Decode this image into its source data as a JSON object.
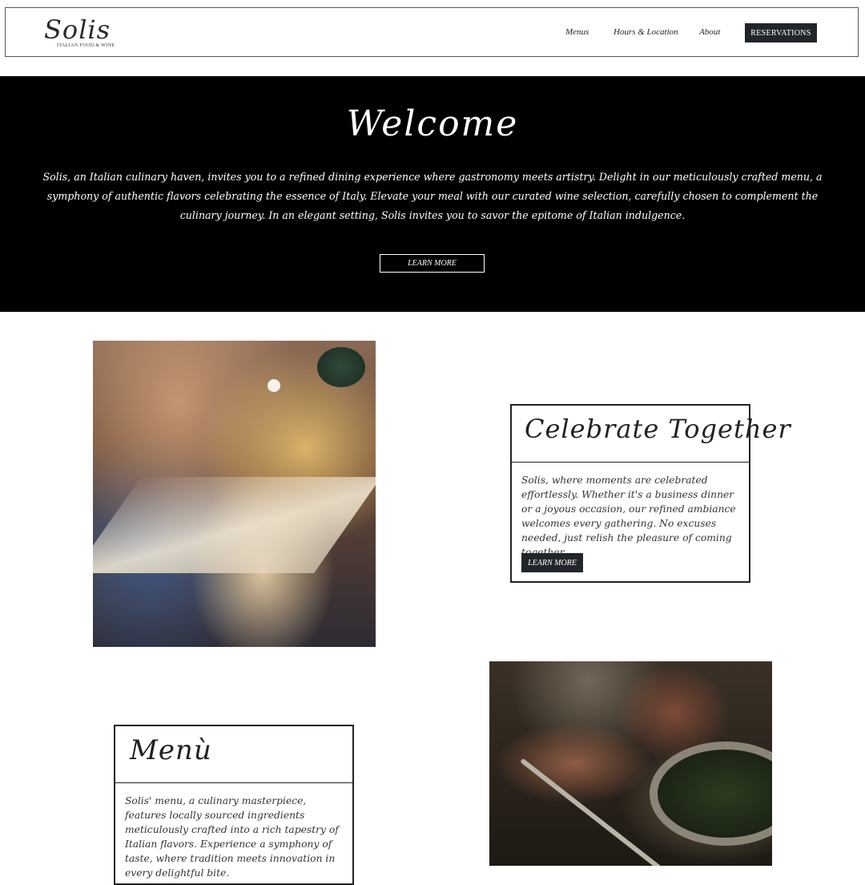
{
  "header": {
    "logo_script": "Solis",
    "logo_subtitle": "ITALIAN FOOD & WINE",
    "nav": {
      "menus": "Menus",
      "hours": "Hours & Location",
      "about": "About"
    },
    "reservations": "RESERVATIONS"
  },
  "hero": {
    "title": "Welcome",
    "text": "Solis, an Italian culinary haven, invites you to a refined dining experience where gastronomy meets artistry. Delight in our meticulously crafted menu, a symphony of authentic flavors celebrating the essence of Italy. Elevate your meal with our curated wine selection, carefully chosen to complement the culinary journey. In an elegant setting, Solis invites you to savor the epitome of Italian indulgence.",
    "button": "LEARN MORE"
  },
  "celebrate": {
    "title": "Celebrate Together",
    "text": "Solis, where moments are celebrated effortlessly. Whether it's a business dinner or a joyous occasion, our refined ambiance welcomes every gathering. No excuses needed, just relish the pleasure of coming together.",
    "button": "LEARN MORE"
  },
  "menu_card": {
    "title": "Menù",
    "text": "Solis' menu, a culinary masterpiece, features locally sourced ingredients meticulously crafted into a rich tapestry of Italian flavors. Experience a symphony of taste, where tradition meets innovation in every delightful bite."
  },
  "colors": {
    "hero_bg": "#000000",
    "button_bg": "#22262b",
    "border": "#222222"
  }
}
